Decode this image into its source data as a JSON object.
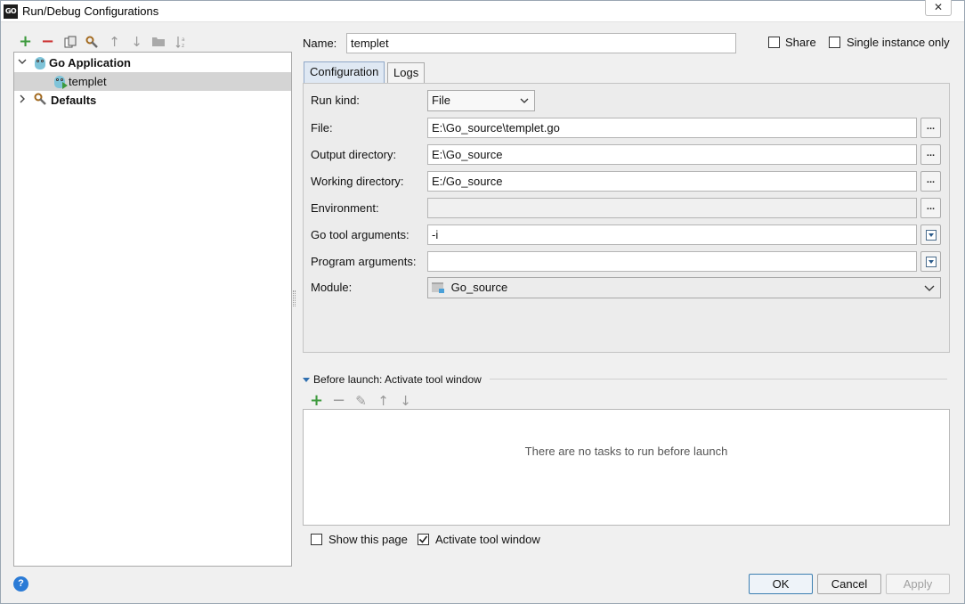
{
  "window": {
    "title": "Run/Debug Configurations",
    "app_icon_text": "GO",
    "close_glyph": "✕"
  },
  "left_toolbar": {
    "icons": [
      "plus-icon",
      "minus-icon",
      "copy-icon",
      "wrench-icon",
      "arrow-up-icon",
      "arrow-down-icon",
      "folder-icon",
      "sort-az-icon"
    ]
  },
  "tree": {
    "items": [
      {
        "label": "Go Application",
        "bold": true,
        "expanded": true
      },
      {
        "label": "templet",
        "bold": false,
        "selected": true
      },
      {
        "label": "Defaults",
        "bold": true,
        "expanded": false
      }
    ]
  },
  "form": {
    "name_label": "Name:",
    "name_value": "templet",
    "share_label": "Share",
    "share_checked": false,
    "single_instance_label": "Single instance only",
    "single_instance_checked": false,
    "tabs": [
      "Configuration",
      "Logs"
    ],
    "active_tab": "Configuration",
    "run_kind_label": "Run kind:",
    "run_kind_value": "File",
    "file_label": "File:",
    "file_value": "E:\\Go_source\\templet.go",
    "output_dir_label": "Output directory:",
    "output_dir_value": "E:\\Go_source",
    "working_dir_label": "Working directory:",
    "working_dir_value": "E:/Go_source",
    "environment_label": "Environment:",
    "environment_value": "",
    "go_tool_args_label": "Go tool arguments:",
    "go_tool_args_value": "-i",
    "program_args_label": "Program arguments:",
    "program_args_value": "",
    "module_label": "Module:",
    "module_value": "Go_source",
    "browse_label": "..."
  },
  "before_launch": {
    "title": "Before launch: Activate tool window",
    "empty_text": "There are no tasks to run before launch",
    "toolbar_icons": [
      "plus-icon",
      "minus-icon",
      "pencil-icon",
      "arrow-up-icon",
      "arrow-down-icon"
    ]
  },
  "footer": {
    "show_this_page_label": "Show this page",
    "show_this_page_checked": false,
    "activate_tool_window_label": "Activate tool window",
    "activate_tool_window_checked": true,
    "ok_label": "OK",
    "cancel_label": "Cancel",
    "apply_label": "Apply",
    "help_glyph": "?"
  },
  "colors": {
    "accent_blue": "#2b7bd6",
    "plus_green": "#3d9a3d",
    "minus_red": "#cc3333",
    "selected_row": "#d4d4d4"
  }
}
